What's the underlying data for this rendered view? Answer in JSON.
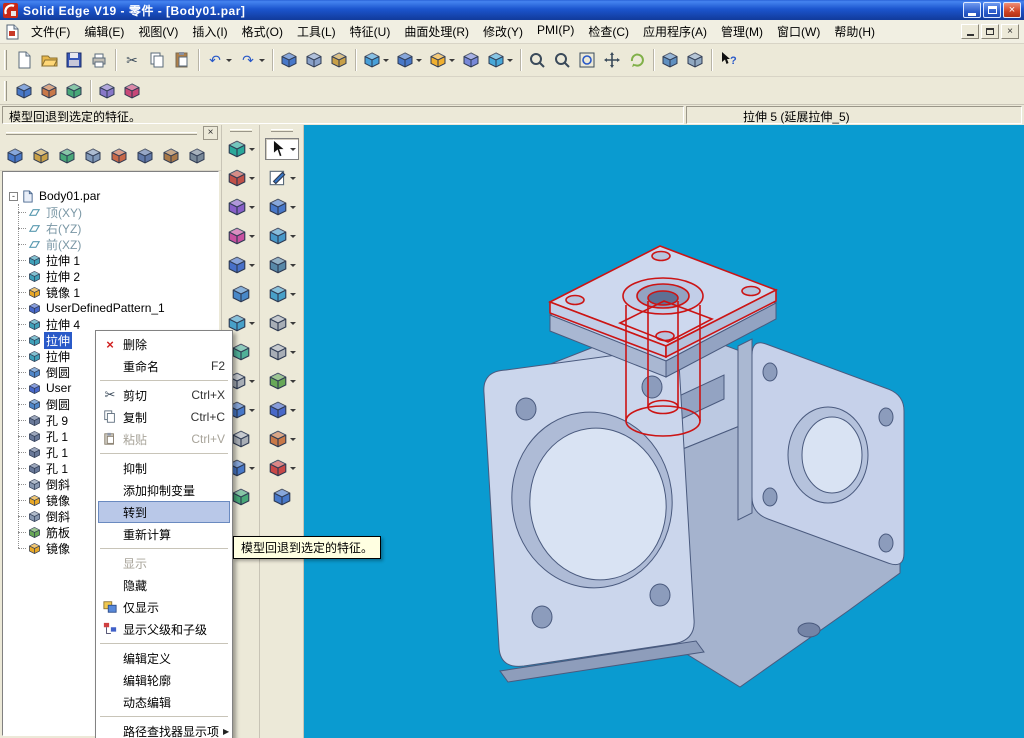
{
  "window": {
    "title": "Solid Edge V19 - 零件 - [Body01.par]",
    "controls": [
      "minimize",
      "maximize",
      "close"
    ],
    "mdi_controls": [
      "minimize",
      "restore",
      "close"
    ]
  },
  "menubar": {
    "items": [
      "文件(F)",
      "编辑(E)",
      "视图(V)",
      "插入(I)",
      "格式(O)",
      "工具(L)",
      "特征(U)",
      "曲面处理(R)",
      "修改(Y)",
      "PMI(P)",
      "检查(C)",
      "应用程序(A)",
      "管理(M)",
      "窗口(W)",
      "帮助(H)"
    ]
  },
  "toolbar_main": {
    "items": [
      {
        "name": "new"
      },
      {
        "name": "open"
      },
      {
        "name": "save"
      },
      {
        "name": "print"
      },
      {
        "name": "cut",
        "sep": true
      },
      {
        "name": "copy"
      },
      {
        "name": "paste"
      },
      {
        "name": "undo",
        "dd": true,
        "sep": true
      },
      {
        "name": "redo",
        "dd": true
      },
      {
        "name": "insert-part-copy",
        "color": "#4878C8",
        "sep": true
      },
      {
        "name": "insert-object",
        "color": "#88A0C8"
      },
      {
        "name": "insert-image",
        "color": "#C8A048"
      },
      {
        "name": "construction-display",
        "color": "#48A0D8",
        "dd": true,
        "sep": true
      },
      {
        "name": "visible-edges",
        "color": "#4878C8",
        "dd": true
      },
      {
        "name": "shaded-view",
        "color": "#F0B030",
        "dd": true
      },
      {
        "name": "common-views",
        "color": "#7888D8"
      },
      {
        "name": "view-orientation",
        "color": "#48A8D8",
        "dd": true
      },
      {
        "name": "zoom-area",
        "sep": true
      },
      {
        "name": "zoom"
      },
      {
        "name": "fit"
      },
      {
        "name": "pan"
      },
      {
        "name": "rotate",
        "color": "#80B048"
      },
      {
        "name": "named-views",
        "color": "#6090C0",
        "sep": true
      },
      {
        "name": "layers",
        "color": "#90A8C0"
      },
      {
        "name": "smart-help",
        "sep": true
      }
    ]
  },
  "toolbar_secondary": {
    "items": [
      {
        "name": "edgebar-toggle",
        "color": "#4878C8"
      },
      {
        "name": "prompt-bar-toggle",
        "color": "#C87848"
      },
      {
        "name": "smartstep-ribbon-toggle",
        "color": "#48A878"
      },
      {
        "name": "variable-table",
        "color": "#8878C8",
        "sep": true
      },
      {
        "name": "feature-playback",
        "color": "#C84878"
      }
    ]
  },
  "prompt_bar": {
    "message": "模型回退到选定的特征。",
    "status": "拉伸 5 (延展拉伸_5)"
  },
  "edgebar": {
    "toolbar_icons": [
      {
        "name": "pathfinder",
        "color": "#4878C8"
      },
      {
        "name": "feature-library",
        "color": "#C8A048"
      },
      {
        "name": "family-of-parts",
        "color": "#48A878"
      },
      {
        "name": "layers-tab",
        "color": "#8098B8"
      },
      {
        "name": "sensors",
        "color": "#C86848"
      },
      {
        "name": "used-sketches",
        "color": "#6078A8"
      },
      {
        "name": "selection-tools",
        "color": "#A87848"
      },
      {
        "name": "edgebar-options",
        "color": "#788898"
      }
    ],
    "tree": {
      "root": {
        "label": "Body01.par",
        "type": "root"
      },
      "items": [
        {
          "label": "顶(XY)",
          "type": "plane",
          "muted": true
        },
        {
          "label": "右(YZ)",
          "type": "plane",
          "muted": true
        },
        {
          "label": "前(XZ)",
          "type": "plane",
          "muted": true
        },
        {
          "label": "拉伸 1",
          "type": "protrusion"
        },
        {
          "label": "拉伸 2",
          "type": "protrusion"
        },
        {
          "label": "镜像 1",
          "type": "mirror"
        },
        {
          "label": "UserDefinedPattern_1",
          "type": "pattern"
        },
        {
          "label": "拉伸 4",
          "type": "protrusion"
        },
        {
          "label": "拉伸",
          "type": "protrusion",
          "selected": true
        },
        {
          "label": "拉伸",
          "type": "protrusion"
        },
        {
          "label": "倒圆",
          "type": "round"
        },
        {
          "label": "User",
          "type": "pattern"
        },
        {
          "label": "倒圆",
          "type": "round"
        },
        {
          "label": "孔 9",
          "type": "hole"
        },
        {
          "label": "孔 1",
          "type": "hole"
        },
        {
          "label": "孔 1",
          "type": "hole"
        },
        {
          "label": "孔 1",
          "type": "hole"
        },
        {
          "label": "倒斜",
          "type": "chamfer"
        },
        {
          "label": "镜像",
          "type": "mirror"
        },
        {
          "label": "倒斜",
          "type": "chamfer"
        },
        {
          "label": "筋板",
          "type": "rib"
        },
        {
          "label": "镜像",
          "type": "mirror"
        }
      ]
    }
  },
  "surfacing_toolbar": {
    "items": [
      {
        "name": "bluesurf",
        "color": "#2AA89A",
        "dd": true
      },
      {
        "name": "revolved-surface",
        "color": "#C05048",
        "dd": true
      },
      {
        "name": "swept-surface",
        "color": "#8860C8",
        "dd": true
      },
      {
        "name": "extruded-surface",
        "color": "#C850A0",
        "dd": true
      },
      {
        "name": "offset-surface",
        "color": "#4870C8",
        "dd": true
      },
      {
        "name": "copy-surface",
        "color": "#4888C8"
      },
      {
        "name": "bounded-surface",
        "color": "#48A0C8",
        "dd": true
      },
      {
        "name": "intersection-curve",
        "color": "#50B098"
      },
      {
        "name": "project-curve",
        "color": "#9AA4AE",
        "disabled": true,
        "dd": true
      },
      {
        "name": "keypoint-curve",
        "color": "#4878C8",
        "dd": true
      },
      {
        "name": "derived-curve",
        "color": "#9AA4AE",
        "disabled": true
      },
      {
        "name": "split-surface",
        "color": "#4878C8",
        "dd": true
      },
      {
        "name": "trim-surface",
        "color": "#48A878"
      }
    ]
  },
  "feature_toolbar": {
    "items": [
      {
        "name": "select-tool",
        "active": true,
        "dd": true
      },
      {
        "name": "sketch",
        "color": "#3878C8",
        "dd": true
      },
      {
        "name": "protrusion",
        "color": "#4878C8",
        "dd": true
      },
      {
        "name": "cutout",
        "color": "#4898C8",
        "dd": true
      },
      {
        "name": "hole-feature",
        "color": "#5888A8",
        "dd": true
      },
      {
        "name": "round-feature",
        "color": "#48A0C8",
        "dd": true
      },
      {
        "name": "chamfer-feature",
        "color": "#9AA4AE",
        "disabled": true,
        "dd": true
      },
      {
        "name": "thin-wall",
        "color": "#9AA4AE",
        "disabled": true,
        "dd": true
      },
      {
        "name": "rib-feature",
        "color": "#68A858",
        "dd": true
      },
      {
        "name": "pattern-feature",
        "color": "#4868C8",
        "dd": true
      },
      {
        "name": "mirror-copy",
        "color": "#C87848",
        "dd": true
      },
      {
        "name": "subtract",
        "color": "#C84848",
        "dd": true
      },
      {
        "name": "part-copy",
        "color": "#4878C8"
      }
    ]
  },
  "context_menu": {
    "items": [
      {
        "label": "删除",
        "icon": "delete"
      },
      {
        "label": "重命名",
        "shortcut": "F2"
      },
      {
        "sep": true
      },
      {
        "label": "剪切",
        "shortcut": "Ctrl+X",
        "icon": "cut"
      },
      {
        "label": "复制",
        "shortcut": "Ctrl+C",
        "icon": "copy"
      },
      {
        "label": "粘贴",
        "shortcut": "Ctrl+V",
        "icon": "paste",
        "disabled": true
      },
      {
        "sep": true
      },
      {
        "label": "抑制"
      },
      {
        "label": "添加抑制变量"
      },
      {
        "label": "转到",
        "highlight": true
      },
      {
        "label": "重新计算"
      },
      {
        "sep": true
      },
      {
        "label": "显示",
        "disabled": true
      },
      {
        "label": "隐藏"
      },
      {
        "label": "仅显示",
        "icon": "show-only"
      },
      {
        "label": "显示父级和子级",
        "icon": "parents-children"
      },
      {
        "sep": true
      },
      {
        "label": "编辑定义"
      },
      {
        "label": "编辑轮廓"
      },
      {
        "label": "动态编辑"
      },
      {
        "sep": true
      },
      {
        "label": "路径查找器显示项",
        "submenu": true
      }
    ]
  },
  "tooltip": {
    "text": "模型回退到选定的特征。"
  },
  "viewport": {
    "background": "#0A9BD0",
    "model_base": "#C7D2EA",
    "highlight_color": "#CC1414",
    "highlighted_feature": "拉伸 5"
  }
}
